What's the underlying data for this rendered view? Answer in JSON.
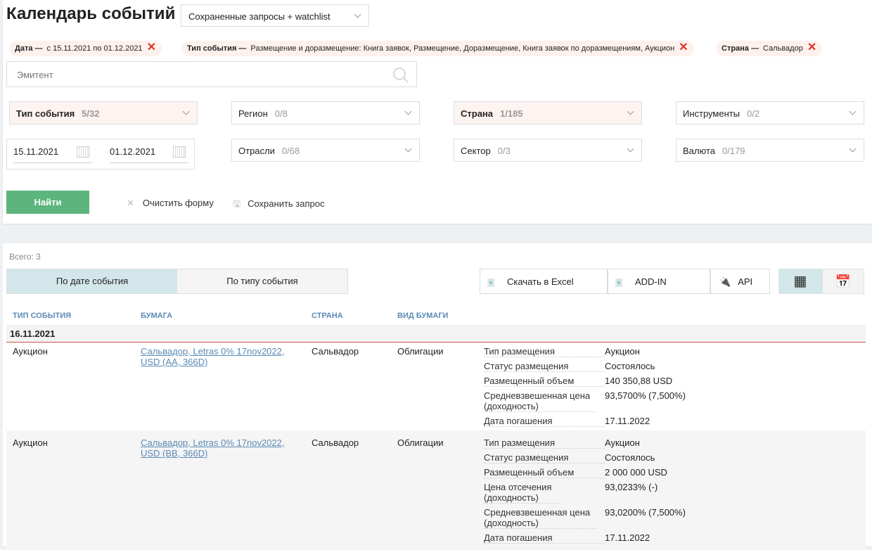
{
  "title": "Календарь событий",
  "saved_queries": "Сохраненные запросы + watchlist",
  "chips": [
    {
      "label": "Дата —",
      "value": "с 15.11.2021 по 01.12.2021"
    },
    {
      "label": "Тип события —",
      "value": "Размещение и доразмещение: Книга заявок, Размещение, Доразмещение, Книга заявок по доразмещениям, Аукцион"
    },
    {
      "label": "Страна —",
      "value": "Сальвадор"
    }
  ],
  "search_placeholder": "Эмитент",
  "filters": {
    "event_type": {
      "label": "Тип события",
      "count": "5/32"
    },
    "region": {
      "label": "Регион",
      "count": "0/8"
    },
    "country": {
      "label": "Страна",
      "count": "1/185"
    },
    "instruments": {
      "label": "Инструменты",
      "count": "0/2"
    },
    "industries": {
      "label": "Отрасли",
      "count": "0/68"
    },
    "sector": {
      "label": "Сектор",
      "count": "0/3"
    },
    "currency": {
      "label": "Валюта",
      "count": "0/179"
    },
    "date_from": "15.11.2021",
    "date_to": "01.12.2021"
  },
  "find": "Найти",
  "clear": "Очистить форму",
  "save": "Сохранить запрос",
  "total": "Всего: 3",
  "tabs": [
    "По дате события",
    "По типу события"
  ],
  "toolbar": {
    "excel": "Скачать в Excel",
    "addin": "ADD-IN",
    "api": "API"
  },
  "columns": [
    "ТИП СОБЫТИЯ",
    "БУМАГА",
    "СТРАНА",
    "ВИД БУМАГИ"
  ],
  "group_date": "16.11.2021",
  "rows": [
    {
      "type": "Аукцион",
      "paper": "Сальвадор, Letras 0% 17nov2022, USD (AA, 366D)",
      "country": "Сальвадор",
      "kind": "Облигации",
      "details": [
        [
          "Тип размещения",
          "Аукцион"
        ],
        [
          "Статус размещения",
          "Состоялось"
        ],
        [
          "Размещенный объем",
          "140 350,88 USD"
        ],
        [
          "Средневзвешенная цена (доходность)",
          "93,5700% (7,500%)"
        ],
        [
          "Дата погашения",
          "17.11.2022"
        ]
      ]
    },
    {
      "type": "Аукцион",
      "paper": "Сальвадор, Letras 0% 17nov2022, USD (BB, 366D)",
      "country": "Сальвадор",
      "kind": "Облигации",
      "details": [
        [
          "Тип размещения",
          "Аукцион"
        ],
        [
          "Статус размещения",
          "Состоялось"
        ],
        [
          "Размещенный объем",
          "2 000 000 USD"
        ],
        [
          "Цена отсечения (доходность)",
          "93,0233% (-)"
        ],
        [
          "Средневзвешенная цена (доходность)",
          "93,0200% (7,500%)"
        ],
        [
          "Дата погашения",
          "17.11.2022"
        ]
      ]
    }
  ]
}
